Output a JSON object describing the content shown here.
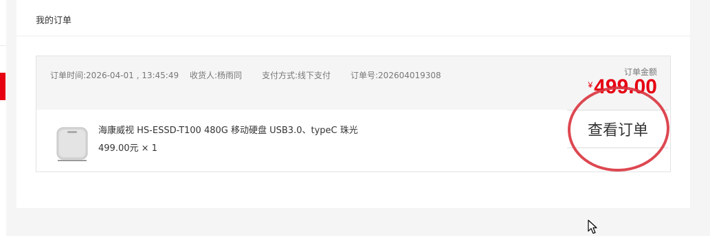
{
  "panel": {
    "title": "我的订单"
  },
  "order": {
    "time_label": "订单时间:",
    "time_value": "2026-04-01 , 13:45:49",
    "receiver_label": "收货人:",
    "receiver_value": "杨雨同",
    "payment_label": "支付方式:",
    "payment_value": "线下支付",
    "order_no_label": "订单号:",
    "order_no_value": "202604019308",
    "amount_label": "订单金额",
    "currency": "¥",
    "amount": "499.00",
    "product_name": "海康威视 HS-ESSD-T100 480G 移动硬盘 USB3.0、typeC 珠光",
    "product_price": "499.00元 × 1",
    "view_button": "查看订单"
  },
  "colors": {
    "accent": "#e60012",
    "annotation_circle": "#d9343e"
  },
  "icons": {
    "cursor": "mouse-pointer-icon",
    "product": "ssd-thumbnail"
  }
}
